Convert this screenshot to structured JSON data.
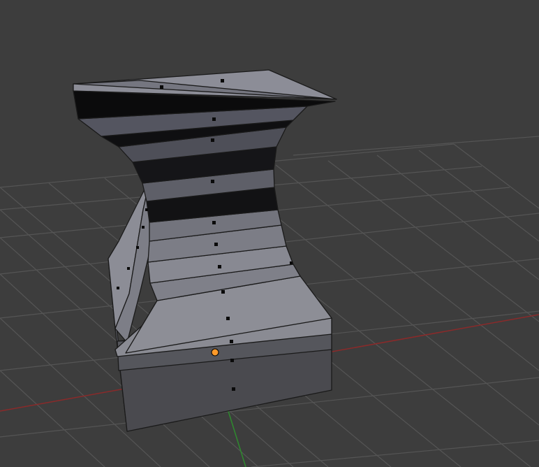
{
  "viewport": {
    "background": "#3d3d3d",
    "grid_color": "#545454",
    "x_axis_color": "#8a2a2a",
    "y_axis_color": "#2e8a2e",
    "object_origin_color": "#ff9a2a",
    "face_dot_color": "#0a0a0a",
    "edge_color": "#1b1b1b"
  },
  "scene": {
    "object": "mesh",
    "mode": "edit",
    "selection": "face"
  }
}
